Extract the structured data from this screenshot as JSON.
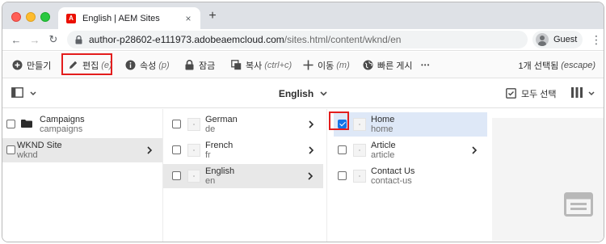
{
  "browser": {
    "tab_title": "English | AEM Sites",
    "favicon_letter": "A",
    "close_glyph": "×",
    "new_tab_glyph": "+",
    "url_host": "author-p28602-e111973.adobeaemcloud.com",
    "url_path": "/sites.html/content/wknd/en",
    "profile_label": "Guest",
    "menu_glyph": "⋮",
    "back_glyph": "←",
    "forward_glyph": "→",
    "reload_glyph": "↻"
  },
  "actions": {
    "create": {
      "label": "만들기"
    },
    "edit": {
      "label": "편집",
      "shortcut": "(e)"
    },
    "properties": {
      "label": "속성",
      "shortcut": "(p)"
    },
    "lock": {
      "label": "잠금"
    },
    "copy": {
      "label": "복사",
      "shortcut": "(ctrl+c)"
    },
    "move": {
      "label": "이동",
      "shortcut": "(m)"
    },
    "quick_publish": {
      "label": "빠른 게시"
    },
    "more_glyph": "•••",
    "selected_count": "1개 선택됨",
    "selected_shortcut": "(escape)"
  },
  "subbar": {
    "breadcrumb": "English",
    "select_all": "모두 선택"
  },
  "columns": [
    {
      "items": [
        {
          "title": "Campaigns",
          "name": "campaigns",
          "icon": "folder-icon",
          "has_children": false,
          "active": false,
          "checked": false
        },
        {
          "title": "WKND Site",
          "name": "wknd",
          "icon": "page-thumbnail",
          "has_children": true,
          "active": true,
          "checked": false
        }
      ]
    },
    {
      "items": [
        {
          "title": "German",
          "name": "de",
          "icon": "page-thumbnail",
          "has_children": true,
          "active": false,
          "checked": false
        },
        {
          "title": "French",
          "name": "fr",
          "icon": "page-thumbnail",
          "has_children": true,
          "active": false,
          "checked": false
        },
        {
          "title": "English",
          "name": "en",
          "icon": "page-thumbnail",
          "has_children": true,
          "active": true,
          "checked": false
        }
      ]
    },
    {
      "items": [
        {
          "title": "Home",
          "name": "home",
          "icon": "page-thumbnail",
          "has_children": false,
          "active": false,
          "checked": true
        },
        {
          "title": "Article",
          "name": "article",
          "icon": "page-thumbnail",
          "has_children": true,
          "active": false,
          "checked": false
        },
        {
          "title": "Contact Us",
          "name": "contact-us",
          "icon": "page-thumbnail",
          "has_children": false,
          "active": false,
          "checked": false
        }
      ]
    }
  ],
  "colors": {
    "highlight_red": "#e31d1d",
    "checkbox_blue": "#1473e6",
    "selected_row": "#dee8f7",
    "active_row": "#e8e8e8"
  }
}
